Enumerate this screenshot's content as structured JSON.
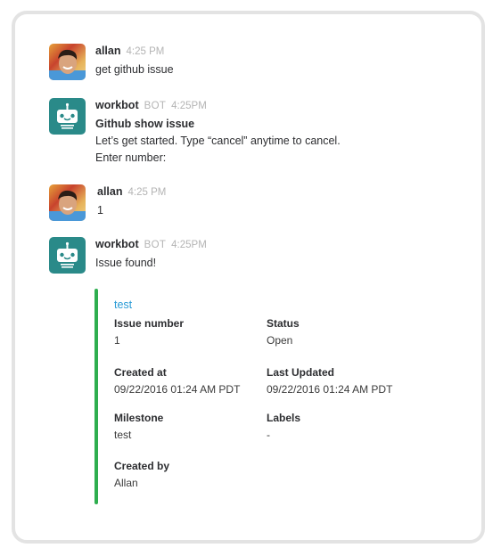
{
  "messages": [
    {
      "sender": "allan",
      "avatar": "user-photo",
      "badge": null,
      "time": "4:25 PM",
      "lines": [
        "get github issue"
      ]
    },
    {
      "sender": "workbot",
      "avatar": "robot-icon",
      "badge": "BOT",
      "time": "4:25PM",
      "title": "Github show issue",
      "lines": [
        "Let’s get started. Type “cancel” anytime to cancel.",
        "Enter number:"
      ]
    },
    {
      "sender": "allan",
      "avatar": "user-photo",
      "badge": null,
      "time": "4:25 PM",
      "lines": [
        "1"
      ]
    },
    {
      "sender": "workbot",
      "avatar": "robot-icon",
      "badge": "BOT",
      "time": "4:25PM",
      "lines": [
        "Issue found!"
      ]
    }
  ],
  "attachment": {
    "title": "test",
    "accent_color": "#2eae4f",
    "fields": [
      {
        "label": "Issue number",
        "value": "1"
      },
      {
        "label": "Status",
        "value": "Open"
      },
      {
        "label": "Created at",
        "value": "09/22/2016 01:24 AM PDT"
      },
      {
        "label": "Last Updated",
        "value": "09/22/2016 01:24 AM PDT"
      },
      {
        "label": "Milestone",
        "value": "test"
      },
      {
        "label": "Labels",
        "value": "-"
      },
      {
        "label": "Created by",
        "value": "Allan"
      }
    ]
  }
}
